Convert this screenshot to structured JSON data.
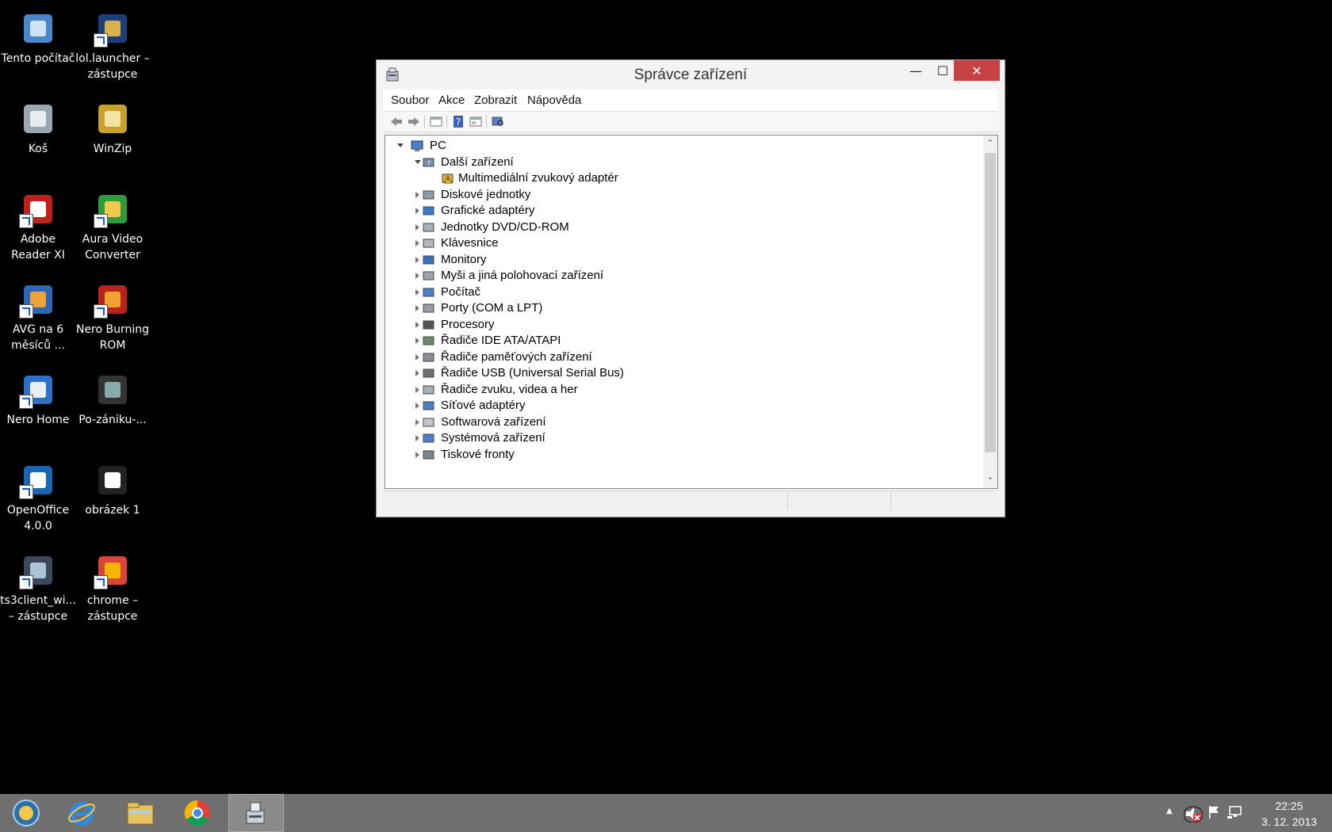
{
  "desktop": {
    "icons": [
      {
        "label": "Tento počítač",
        "icon": "computer-icon"
      },
      {
        "label": "lol.launcher – zástupce",
        "icon": "lol-launcher-icon"
      },
      {
        "label": "Koš",
        "icon": "recycle-bin-icon"
      },
      {
        "label": "WinZip",
        "icon": "winzip-icon"
      },
      {
        "label": "Adobe Reader XI",
        "icon": "adobe-reader-icon"
      },
      {
        "label": "Aura Video Converter",
        "icon": "aura-video-converter-icon"
      },
      {
        "label": "AVG na 6 měsíců ...",
        "icon": "avg-icon"
      },
      {
        "label": "Nero Burning ROM",
        "icon": "nero-burning-rom-icon"
      },
      {
        "label": "Nero Home",
        "icon": "nero-home-icon"
      },
      {
        "label": "Po-zániku-...",
        "icon": "video-file-icon"
      },
      {
        "label": "OpenOffice 4.0.0",
        "icon": "openoffice-icon"
      },
      {
        "label": "obrázek 1",
        "icon": "image-file-icon"
      },
      {
        "label": "ts3client_wi... – zástupce",
        "icon": "teamspeak-icon"
      },
      {
        "label": "chrome – zástupce",
        "icon": "chrome-icon"
      }
    ]
  },
  "window": {
    "title": "Správce zařízení",
    "menu": [
      "Soubor",
      "Akce",
      "Zobrazit",
      "Nápověda"
    ],
    "toolbar": [
      "back-icon",
      "forward-icon",
      "properties-icon",
      "help-icon",
      "view-icon",
      "scan-hardware-icon"
    ],
    "tree": {
      "root": "PC",
      "items": [
        {
          "label": "Další zařízení",
          "level": 1,
          "expanded": true,
          "icon": "unknown-device-icon"
        },
        {
          "label": "Multimediální zvukový adaptér",
          "level": 2,
          "expanded": null,
          "icon": "warning-device-icon"
        },
        {
          "label": "Diskové jednotky",
          "level": 1,
          "expanded": false,
          "icon": "disk-drive-icon"
        },
        {
          "label": "Grafické adaptéry",
          "level": 1,
          "expanded": false,
          "icon": "display-adapter-icon"
        },
        {
          "label": "Jednotky DVD/CD-ROM",
          "level": 1,
          "expanded": false,
          "icon": "dvd-drive-icon"
        },
        {
          "label": "Klávesnice",
          "level": 1,
          "expanded": false,
          "icon": "keyboard-icon"
        },
        {
          "label": "Monitory",
          "level": 1,
          "expanded": false,
          "icon": "monitor-icon"
        },
        {
          "label": "Myši a jiná polohovací zařízení",
          "level": 1,
          "expanded": false,
          "icon": "mouse-icon"
        },
        {
          "label": "Počítač",
          "level": 1,
          "expanded": false,
          "icon": "computer-icon"
        },
        {
          "label": "Porty (COM a LPT)",
          "level": 1,
          "expanded": false,
          "icon": "port-icon"
        },
        {
          "label": "Procesory",
          "level": 1,
          "expanded": false,
          "icon": "processor-icon"
        },
        {
          "label": "Řadiče IDE ATA/ATAPI",
          "level": 1,
          "expanded": false,
          "icon": "ide-controller-icon"
        },
        {
          "label": "Řadiče paměťových zařízení",
          "level": 1,
          "expanded": false,
          "icon": "storage-controller-icon"
        },
        {
          "label": "Řadiče USB (Universal Serial Bus)",
          "level": 1,
          "expanded": false,
          "icon": "usb-icon"
        },
        {
          "label": "Řadiče zvuku, videa a her",
          "level": 1,
          "expanded": false,
          "icon": "sound-icon"
        },
        {
          "label": "Síťové adaptéry",
          "level": 1,
          "expanded": false,
          "icon": "network-adapter-icon"
        },
        {
          "label": "Softwarová zařízení",
          "level": 1,
          "expanded": false,
          "icon": "software-device-icon"
        },
        {
          "label": "Systémová zařízení",
          "level": 1,
          "expanded": false,
          "icon": "system-device-icon"
        },
        {
          "label": "Tiskové fronty",
          "level": 1,
          "expanded": false,
          "icon": "printer-icon"
        }
      ]
    }
  },
  "taskbar": {
    "apps": [
      "start-orb-icon",
      "internet-explorer-icon",
      "file-explorer-icon",
      "chrome-icon",
      "device-manager-icon"
    ],
    "clock": {
      "time": "22:25",
      "date": "3. 12. 2013"
    }
  },
  "colors": {
    "close_button": "#c74343",
    "taskbar": "#6f6f6f",
    "desktop": "#000000"
  }
}
